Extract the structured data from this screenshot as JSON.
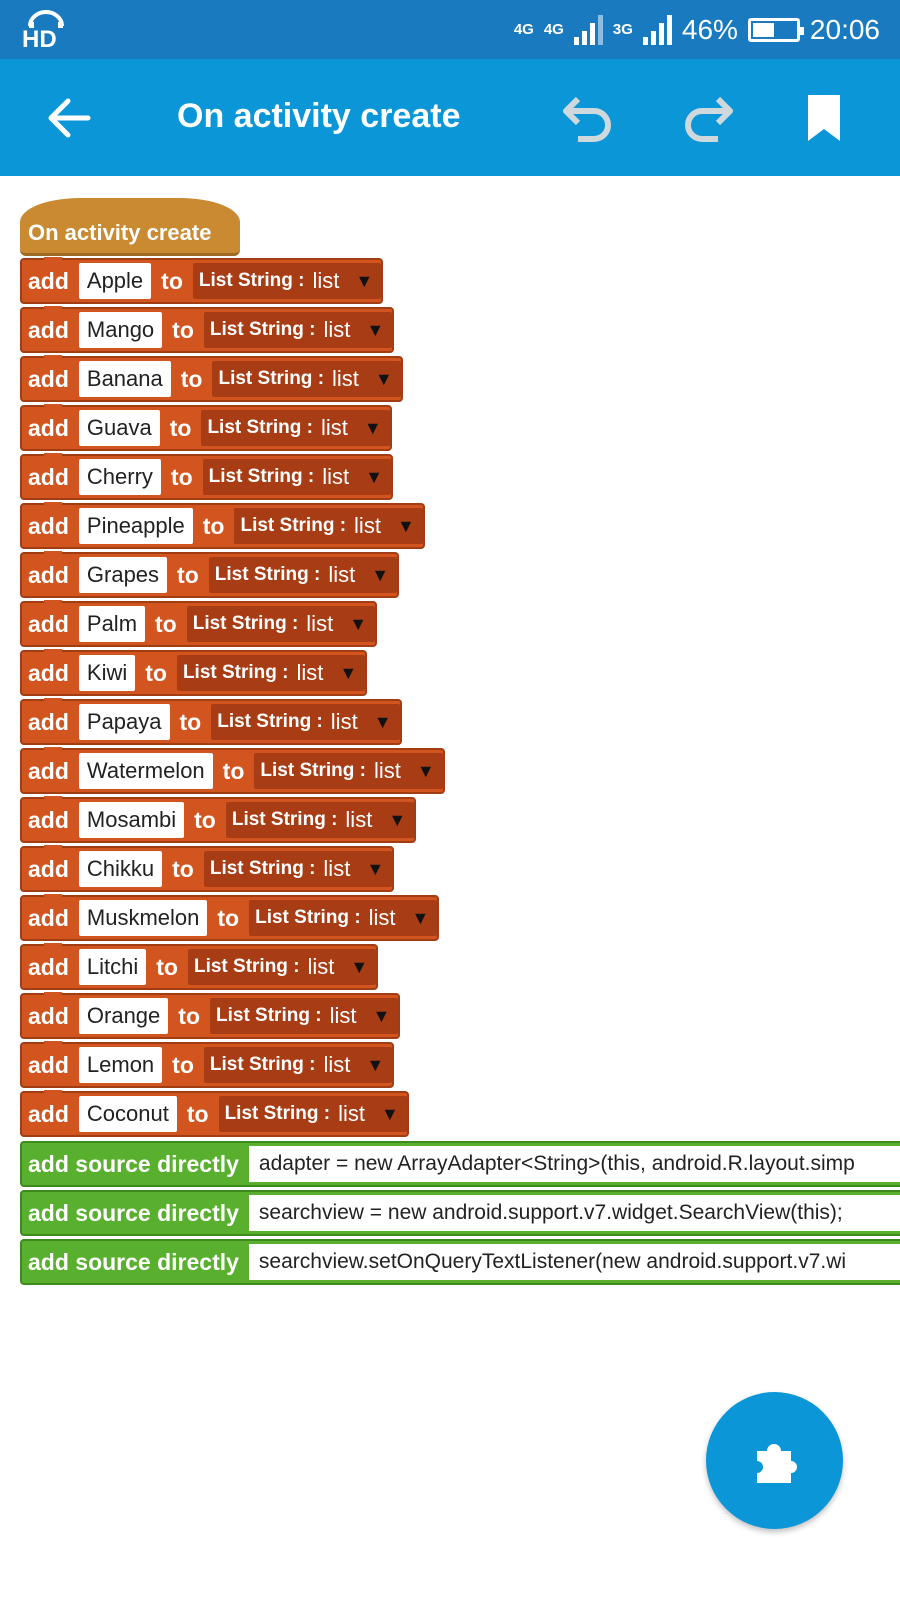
{
  "status_bar": {
    "hd_label": "HD",
    "net_primary": "4G",
    "net_secondary": "4G",
    "net_tertiary": "3G",
    "battery": "46%",
    "battery_level": 0.46,
    "time": "20:06"
  },
  "app_bar": {
    "title": "On activity create",
    "back_icon": "arrow-left-icon",
    "undo_icon": "undo-icon",
    "redo_icon": "redo-icon",
    "bookmark_icon": "bookmark-icon"
  },
  "colors": {
    "status_bar": "#1a7ac0",
    "app_bar": "#0b96d8",
    "event_block": "#c98a31",
    "list_block": "#d2551f",
    "source_block": "#58b02e",
    "fab": "#0b96d8"
  },
  "event_block": {
    "label": "On activity create"
  },
  "list_blocks": {
    "add_kw": "add",
    "to_kw": "to",
    "type_label": "List String :",
    "list_value": "list",
    "arrow": "▼",
    "items": [
      "Apple",
      "Mango",
      "Banana",
      "Guava",
      "Cherry",
      "Pineapple",
      "Grapes",
      "Palm",
      "Kiwi",
      "Papaya",
      "Watermelon",
      "Mosambi",
      "Chikku",
      "Muskmelon",
      "Litchi",
      "Orange",
      "Lemon",
      "Coconut"
    ]
  },
  "source_blocks": {
    "label": "add source directly",
    "items": [
      "adapter = new ArrayAdapter<String>(this, android.R.layout.simp",
      "searchview = new android.support.v7.widget.SearchView(this);",
      "searchview.setOnQueryTextListener(new android.support.v7.wi"
    ]
  },
  "fab": {
    "icon": "puzzle-piece-icon"
  }
}
